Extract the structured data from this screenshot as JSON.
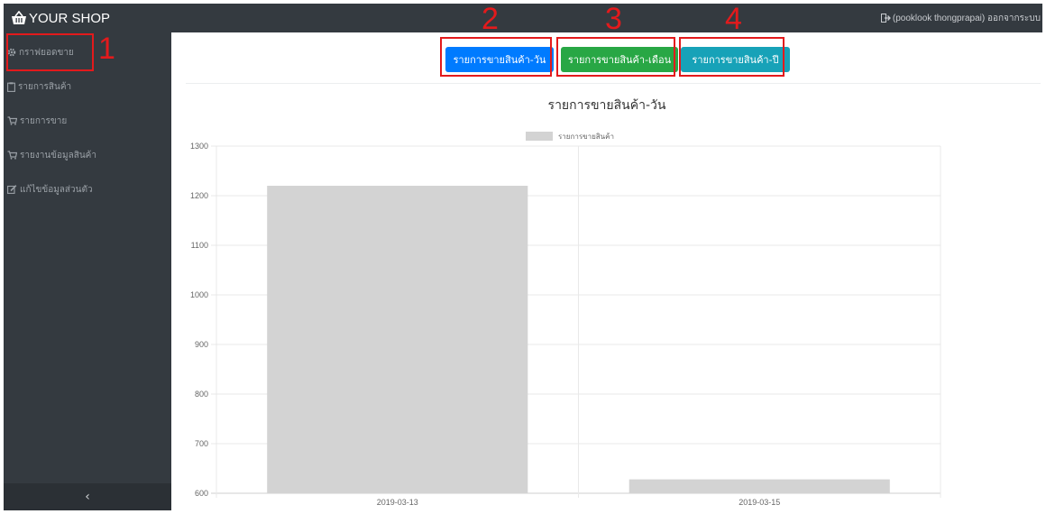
{
  "header": {
    "brand_label": "YOUR SHOP",
    "user_label": "(pooklook thongprapai) ออกจากระบบ"
  },
  "sidebar": {
    "items": [
      {
        "label": "กราฟยอดขาย",
        "icon": "gear-icon"
      },
      {
        "label": "รายการสินค้า",
        "icon": "clipboard-icon"
      },
      {
        "label": "รายการขาย",
        "icon": "cart-icon"
      },
      {
        "label": "รายงานข้อมูลสินค้า",
        "icon": "cart-icon"
      },
      {
        "label": "แก้ไขข้อมูลส่วนตัว",
        "icon": "edit-icon"
      }
    ],
    "toggle_label": "‹"
  },
  "annotations": [
    "1",
    "2",
    "3",
    "4"
  ],
  "tabs": [
    {
      "label": "รายการขายสินค้า-วัน"
    },
    {
      "label": "รายการขายสินค้า-เดือน"
    },
    {
      "label": "รายการขายสินค้า-ปี"
    }
  ],
  "colors": {
    "topbar": "#343a40",
    "btn_day": "#007bff",
    "btn_month": "#28a745",
    "btn_year": "#17a2b8",
    "bar": "#d3d3d3",
    "annotation": "#e31a1c"
  },
  "chart_data": {
    "type": "bar",
    "title": "รายการขายสินค้า-วัน",
    "categories": [
      "2019-03-13",
      "2019-03-15"
    ],
    "series": [
      {
        "name": "รายการขายสินค้า",
        "values": [
          1220,
          628
        ]
      }
    ],
    "ylim": [
      600,
      1300
    ],
    "yticks": [
      600,
      700,
      800,
      900,
      1000,
      1100,
      1200,
      1300
    ],
    "grid": true,
    "legend": "top"
  }
}
